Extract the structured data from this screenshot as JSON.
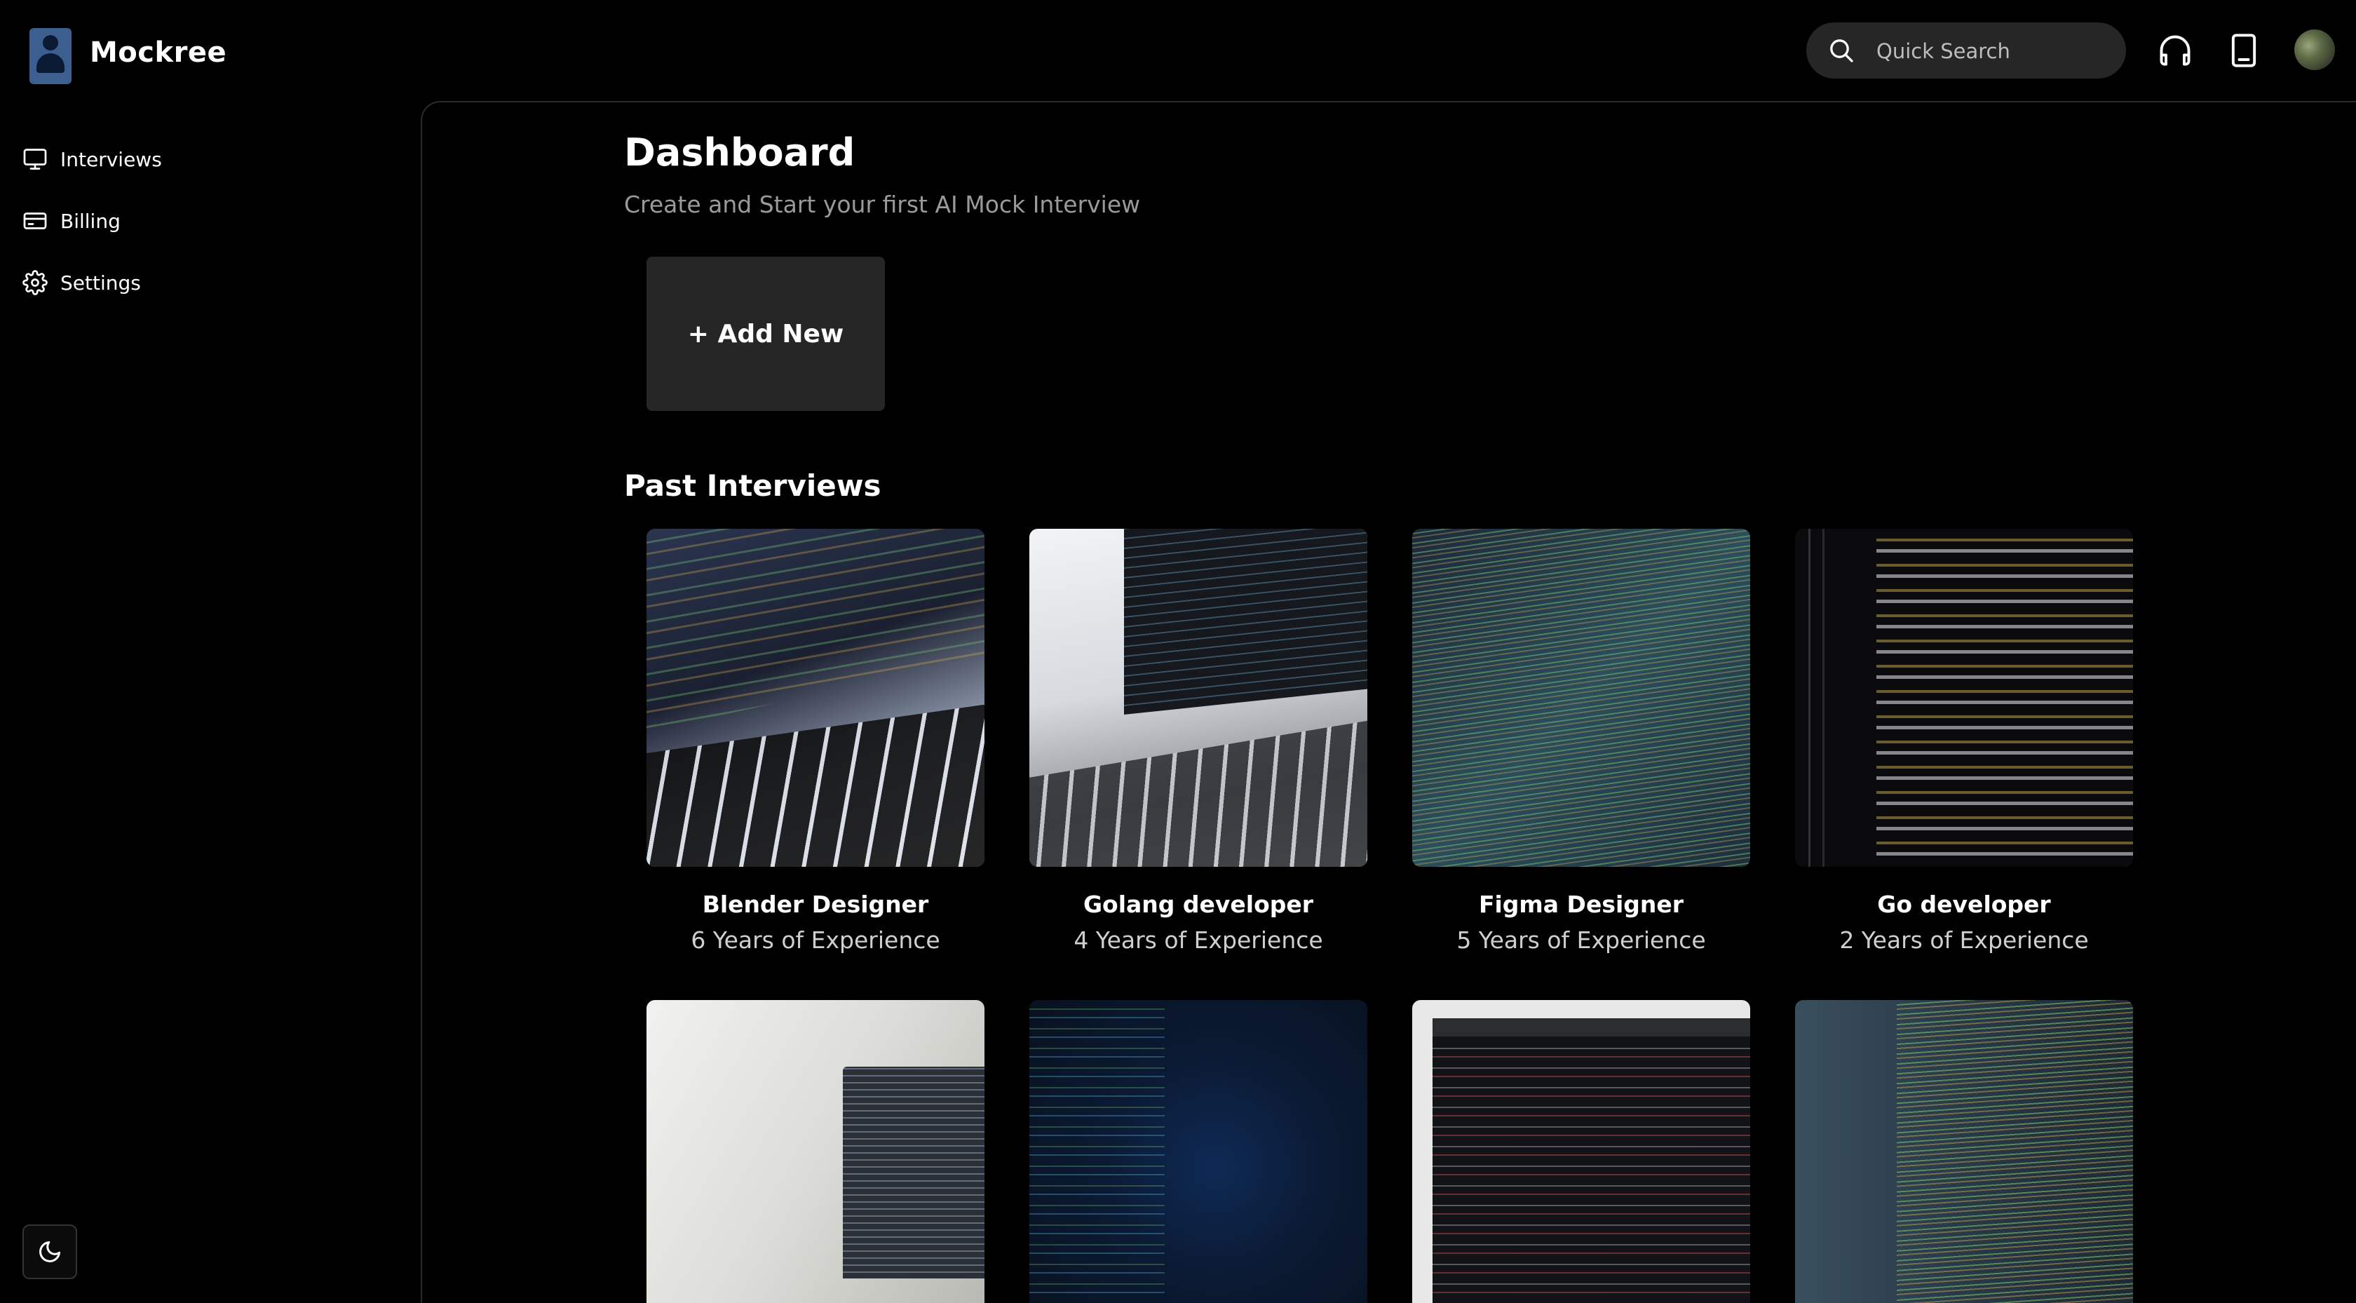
{
  "app": {
    "brand": "Mockree"
  },
  "header": {
    "search_placeholder": "Quick Search",
    "icons": [
      "search-icon",
      "headphones-icon",
      "tablet-icon"
    ]
  },
  "sidebar": {
    "items": [
      {
        "label": "Interviews",
        "icon": "monitor-icon"
      },
      {
        "label": "Billing",
        "icon": "credit-card-icon"
      },
      {
        "label": "Settings",
        "icon": "gear-icon"
      }
    ],
    "theme_toggle_icon": "moon-icon"
  },
  "main": {
    "title": "Dashboard",
    "subtitle": "Create and Start your first AI Mock Interview",
    "add_button": "+ Add New",
    "past_title": "Past Interviews",
    "interviews": [
      {
        "role": "Blender Designer",
        "experience": "6 Years of Experience"
      },
      {
        "role": "Golang developer",
        "experience": "4 Years of Experience"
      },
      {
        "role": "Figma Designer",
        "experience": "5 Years of Experience"
      },
      {
        "role": "Go developer",
        "experience": "2 Years of Experience"
      }
    ]
  }
}
